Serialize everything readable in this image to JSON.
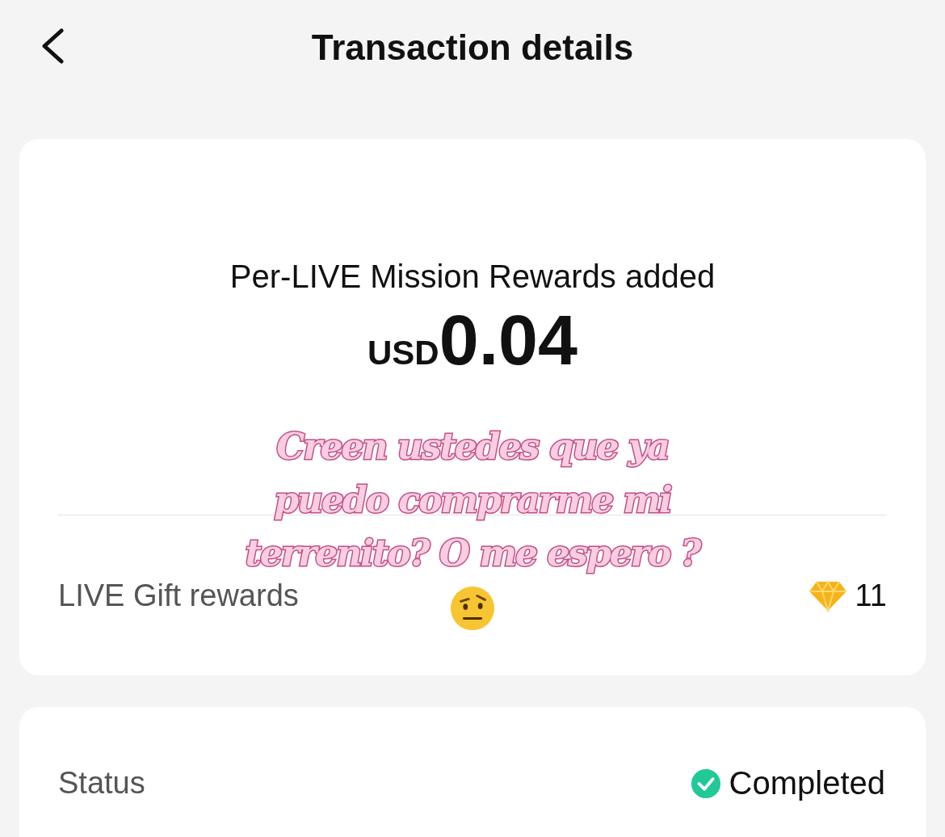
{
  "header": {
    "title": "Transaction details"
  },
  "summary": {
    "title": "Per-LIVE Mission Rewards added",
    "currency": "USD",
    "amount": "0.04",
    "rows": [
      {
        "label": "LIVE Gift rewards",
        "value": "11"
      }
    ]
  },
  "status": {
    "label": "Status",
    "value": "Completed"
  },
  "caption": {
    "lines": [
      "Creen ustedes que ya",
      "puedo comprarme mi",
      "terrenito? O me espero ?"
    ]
  }
}
